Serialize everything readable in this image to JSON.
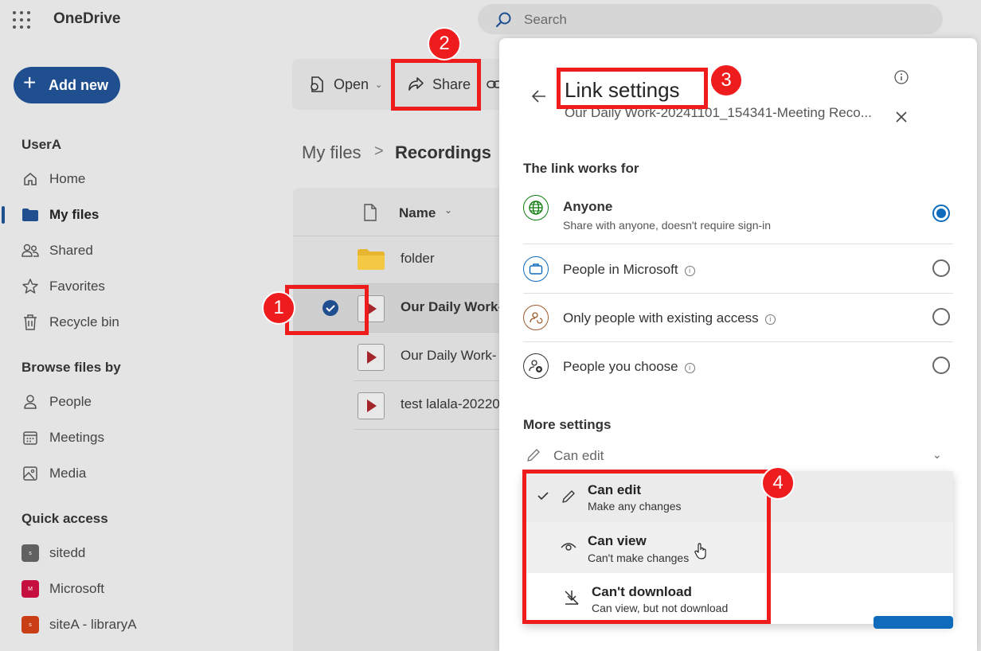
{
  "app": {
    "name": "OneDrive"
  },
  "search": {
    "placeholder": "Search"
  },
  "sidebar": {
    "add_new": "Add new",
    "user_header": "UserA",
    "main_items": [
      {
        "label": "Home",
        "icon": "home-icon"
      },
      {
        "label": "My files",
        "icon": "folder-icon",
        "active": true
      },
      {
        "label": "Shared",
        "icon": "people-icon"
      },
      {
        "label": "Favorites",
        "icon": "star-icon"
      },
      {
        "label": "Recycle bin",
        "icon": "trash-icon"
      }
    ],
    "browse_header": "Browse files by",
    "browse_items": [
      {
        "label": "People",
        "icon": "person-icon"
      },
      {
        "label": "Meetings",
        "icon": "calendar-icon"
      },
      {
        "label": "Media",
        "icon": "image-icon"
      }
    ],
    "quick_header": "Quick access",
    "quick_items": [
      {
        "label": "sitedd",
        "badge": "s",
        "color": "#616161"
      },
      {
        "label": "Microsoft",
        "badge": "M",
        "color": "#c50f3f"
      },
      {
        "label": "siteA - libraryA",
        "badge": "s",
        "color": "#ca3e16"
      }
    ]
  },
  "toolbar": {
    "open": "Open",
    "share": "Share"
  },
  "breadcrumb": {
    "root": "My files",
    "separator": ">",
    "current": "Recordings"
  },
  "file_list": {
    "header_name": "Name",
    "rows": [
      {
        "name": "folder",
        "type": "folder"
      },
      {
        "name": "Our Daily Work-",
        "type": "video",
        "selected": true
      },
      {
        "name": "Our Daily Work-",
        "type": "video"
      },
      {
        "name": "test lalala-20220",
        "type": "video"
      }
    ]
  },
  "link_settings": {
    "title": "Link settings",
    "subtitle": "Our Daily Work-20241101_154341-Meeting Reco...",
    "works_for_header": "The link works for",
    "options": [
      {
        "title": "Anyone",
        "desc": "Share with anyone, doesn't require sign-in",
        "icon": "globe-icon",
        "selected": true,
        "info": false
      },
      {
        "title": "People in Microsoft",
        "desc": "",
        "icon": "briefcase-icon",
        "selected": false,
        "info": true
      },
      {
        "title": "Only people with existing access",
        "desc": "",
        "icon": "person-refresh-icon",
        "selected": false,
        "info": true
      },
      {
        "title": "People you choose",
        "desc": "",
        "icon": "person-add-icon",
        "selected": false,
        "info": true
      }
    ],
    "more_settings_header": "More settings",
    "permission_value": "Can edit",
    "dropdown": [
      {
        "title": "Can edit",
        "desc": "Make any changes",
        "checked": true,
        "icon": "pencil-icon"
      },
      {
        "title": "Can view",
        "desc": "Can't make changes",
        "checked": false,
        "icon": "eye-icon"
      },
      {
        "title": "Can't download",
        "desc": "Can view, but not download",
        "checked": false,
        "icon": "no-download-icon"
      }
    ]
  },
  "annotations": {
    "step1": "1",
    "step2": "2",
    "step3": "3",
    "step4": "4"
  },
  "colors": {
    "annotation_red": "#ee1c1c",
    "brand_blue": "#0f6cbd",
    "nav_blue": "#1f4f8f"
  }
}
